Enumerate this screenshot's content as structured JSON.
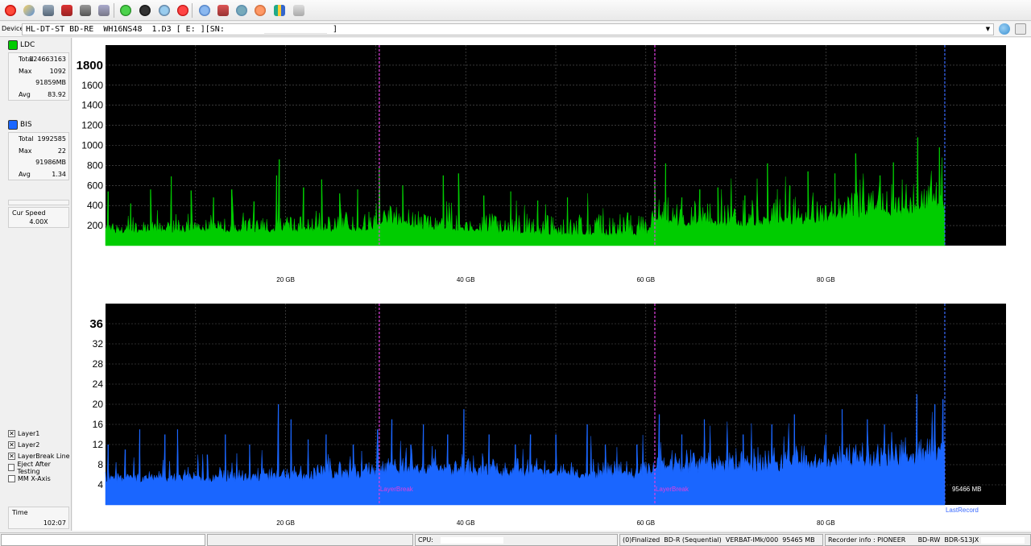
{
  "device": {
    "label": "Device:",
    "text": "HL-DT-ST BD-RE  WH16NS48  1.D3 [ E: ][SN:",
    "close": "]"
  },
  "toolbar": {
    "icons": [
      "power-icon",
      "settings-icon",
      "drive-icon",
      "erase-icon",
      "disc-icon",
      "disc-copy-icon",
      "refresh-icon",
      "start-icon",
      "verify-icon",
      "stop-icon",
      "disc-info-icon",
      "media-icon",
      "network-icon",
      "burn-icon",
      "report-icon",
      "print-icon"
    ]
  },
  "legend": {
    "ldc": {
      "label": "LDC",
      "color": "#00cc00"
    },
    "bis": {
      "label": "BIS",
      "color": "#1a66ff"
    }
  },
  "ldc_stats": [
    {
      "k": "Total",
      "v": "124663163"
    },
    {
      "k": "Max",
      "v": "1092"
    },
    {
      "k": "",
      "v": "91859MB"
    },
    {
      "k": "Avg",
      "v": "83.92"
    }
  ],
  "bis_stats": [
    {
      "k": "Total",
      "v": "1992585"
    },
    {
      "k": "Max",
      "v": "22"
    },
    {
      "k": "",
      "v": "91986MB"
    },
    {
      "k": "Avg",
      "v": "1.34"
    }
  ],
  "speed": {
    "label": "Cur Speed",
    "value": "4.00X"
  },
  "options": [
    {
      "label": "Layer1",
      "checked": true
    },
    {
      "label": "Layer2",
      "checked": true
    },
    {
      "label": "LayerBreak Line",
      "checked": true
    },
    {
      "label": "Eject After Testing",
      "checked": false
    },
    {
      "label": "MM X-Axis",
      "checked": false
    }
  ],
  "time": {
    "label": "Time",
    "value": "102:07"
  },
  "chart_data": [
    {
      "type": "area",
      "name": "LDC",
      "color": "#00cc00",
      "background": "#000000",
      "xlim": [
        0,
        100
      ],
      "ylim": [
        0,
        2000
      ],
      "x_ticks": [
        20,
        40,
        60,
        80
      ],
      "x_tick_labels": [
        "20 GB",
        "40 GB",
        "60 GB",
        "80 GB"
      ],
      "y_ticks": [
        200,
        400,
        600,
        800,
        1000,
        1200,
        1400,
        1600,
        1800
      ],
      "y_tick_labels": [
        "200",
        "400",
        "600",
        "800",
        "1000",
        "1200",
        "1400",
        "1600",
        "1800"
      ],
      "data_end": 93.2,
      "layer_breaks": [
        30.4,
        61.0
      ],
      "baseline": [
        [
          0,
          130
        ],
        [
          5,
          140
        ],
        [
          10,
          150
        ],
        [
          15,
          150
        ],
        [
          20,
          150
        ],
        [
          25,
          160
        ],
        [
          30,
          170
        ],
        [
          31,
          250
        ],
        [
          35,
          180
        ],
        [
          40,
          150
        ],
        [
          45,
          130
        ],
        [
          50,
          120
        ],
        [
          55,
          110
        ],
        [
          60,
          100
        ],
        [
          61,
          250
        ],
        [
          65,
          200
        ],
        [
          70,
          220
        ],
        [
          75,
          230
        ],
        [
          80,
          260
        ],
        [
          85,
          300
        ],
        [
          88,
          330
        ],
        [
          90,
          370
        ],
        [
          93.2,
          420
        ]
      ],
      "peaks": [
        [
          0.3,
          540
        ],
        [
          2.8,
          420
        ],
        [
          5,
          560
        ],
        [
          7.3,
          690
        ],
        [
          9.5,
          550
        ],
        [
          12,
          480
        ],
        [
          14,
          560
        ],
        [
          16.5,
          440
        ],
        [
          19,
          700
        ],
        [
          19.3,
          860
        ],
        [
          22,
          580
        ],
        [
          24,
          660
        ],
        [
          26,
          520
        ],
        [
          28,
          560
        ],
        [
          30.4,
          780
        ],
        [
          33,
          600
        ],
        [
          37.5,
          700
        ],
        [
          39.2,
          720
        ],
        [
          42,
          500
        ],
        [
          45,
          540
        ],
        [
          48,
          450
        ],
        [
          51.3,
          480
        ],
        [
          55,
          300
        ],
        [
          58,
          330
        ],
        [
          61,
          660
        ],
        [
          62.2,
          820
        ],
        [
          64,
          480
        ],
        [
          66,
          560
        ],
        [
          68,
          580
        ],
        [
          71,
          500
        ],
        [
          73.5,
          820
        ],
        [
          76,
          600
        ],
        [
          78,
          740
        ],
        [
          81,
          720
        ],
        [
          83.3,
          920
        ],
        [
          86,
          700
        ],
        [
          87.5,
          830
        ],
        [
          90.2,
          1080
        ],
        [
          92.6,
          980
        ]
      ]
    },
    {
      "type": "area",
      "name": "BIS",
      "color": "#1a66ff",
      "background": "#000000",
      "xlim": [
        0,
        100
      ],
      "ylim": [
        0,
        40
      ],
      "x_ticks": [
        20,
        40,
        60,
        80
      ],
      "x_tick_labels": [
        "20 GB",
        "40 GB",
        "60 GB",
        "80 GB"
      ],
      "y_ticks": [
        4,
        8,
        12,
        16,
        20,
        24,
        28,
        32,
        36
      ],
      "y_tick_labels": [
        "4",
        "8",
        "12",
        "16",
        "20",
        "24",
        "28",
        "32",
        "36"
      ],
      "data_end": 93.2,
      "layer_breaks": [
        30.4,
        61.0
      ],
      "layer_break_label": "LayerBreak",
      "end_label": "95466 MB",
      "last_record_label": "LastRecord",
      "baseline": [
        [
          0,
          5
        ],
        [
          10,
          5
        ],
        [
          20,
          5.5
        ],
        [
          30,
          6
        ],
        [
          31,
          7
        ],
        [
          40,
          6.5
        ],
        [
          50,
          6
        ],
        [
          60,
          5.5
        ],
        [
          61,
          7
        ],
        [
          70,
          7.5
        ],
        [
          80,
          8
        ],
        [
          85,
          8.5
        ],
        [
          90,
          9
        ],
        [
          93.2,
          10
        ]
      ],
      "peaks": [
        [
          0.3,
          12
        ],
        [
          2.2,
          11
        ],
        [
          3.8,
          15
        ],
        [
          6.6,
          14
        ],
        [
          8,
          15
        ],
        [
          11.3,
          10
        ],
        [
          13.3,
          14
        ],
        [
          16,
          12
        ],
        [
          19.2,
          20
        ],
        [
          20.6,
          17
        ],
        [
          22.5,
          13
        ],
        [
          24.5,
          14
        ],
        [
          27.5,
          12
        ],
        [
          30.2,
          15
        ],
        [
          31.8,
          17
        ],
        [
          33.9,
          12
        ],
        [
          35.3,
          16
        ],
        [
          38,
          14
        ],
        [
          39.8,
          19
        ],
        [
          42.6,
          14
        ],
        [
          45.5,
          12
        ],
        [
          47.2,
          14
        ],
        [
          50,
          14
        ],
        [
          53.5,
          16
        ],
        [
          55.5,
          12
        ],
        [
          59,
          12
        ],
        [
          61.5,
          18
        ],
        [
          64,
          14
        ],
        [
          66.5,
          17
        ],
        [
          70.8,
          14
        ],
        [
          74,
          16
        ],
        [
          76.5,
          18
        ],
        [
          80,
          14
        ],
        [
          81.8,
          19
        ],
        [
          84.6,
          17
        ],
        [
          86.5,
          16
        ],
        [
          90.1,
          22
        ],
        [
          92.1,
          20
        ],
        [
          93,
          21
        ]
      ]
    }
  ]
}
